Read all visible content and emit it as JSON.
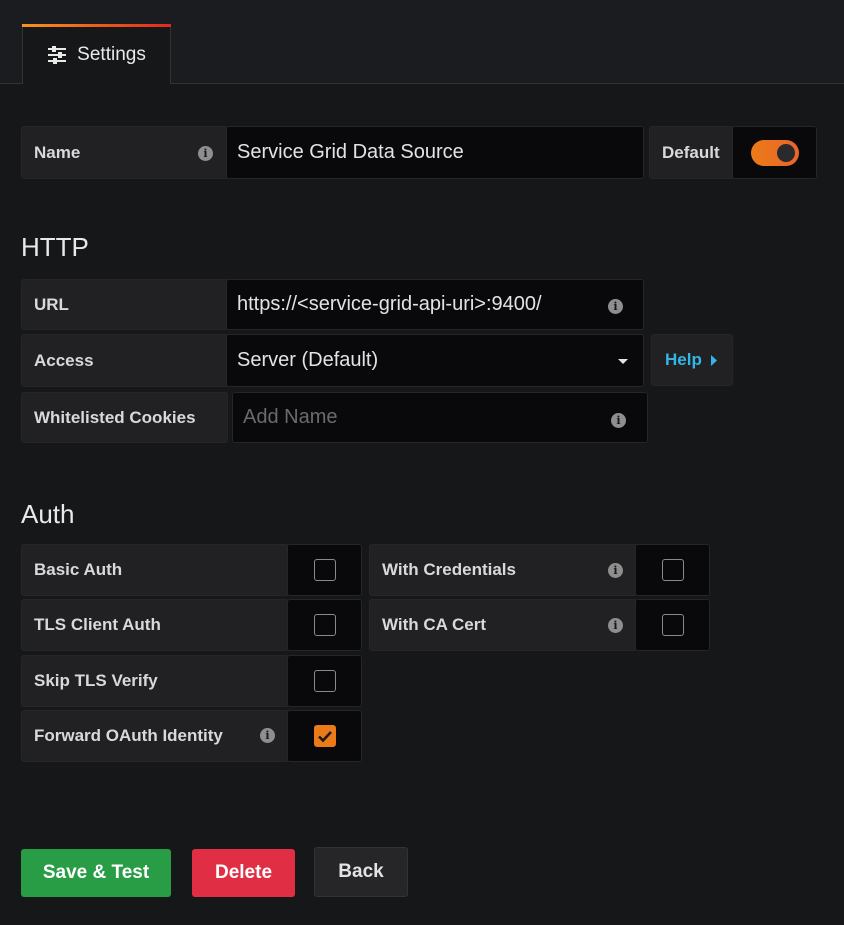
{
  "tab": {
    "label": "Settings"
  },
  "name_row": {
    "label": "Name",
    "value": "Service Grid Data Source",
    "default_label": "Default",
    "default_on": true
  },
  "http": {
    "heading": "HTTP",
    "url_label": "URL",
    "url_value": "https://<service-grid-api-uri>:9400/",
    "access_label": "Access",
    "access_value": "Server (Default)",
    "help_label": "Help",
    "cookies_label": "Whitelisted Cookies",
    "cookies_placeholder": "Add Name"
  },
  "auth": {
    "heading": "Auth",
    "basic": "Basic Auth",
    "with_credentials": "With Credentials",
    "tls_client": "TLS Client Auth",
    "with_ca": "With CA Cert",
    "skip_tls": "Skip TLS Verify",
    "forward_oauth": "Forward OAuth Identity",
    "states": {
      "basic": false,
      "with_credentials": false,
      "tls_client": false,
      "with_ca": false,
      "skip_tls": false,
      "forward_oauth": true
    }
  },
  "buttons": {
    "save": "Save & Test",
    "delete": "Delete",
    "back": "Back"
  },
  "colors": {
    "accent": "#eb7b18",
    "save": "#299c46",
    "delete": "#e02f44",
    "link": "#33b5e5"
  }
}
